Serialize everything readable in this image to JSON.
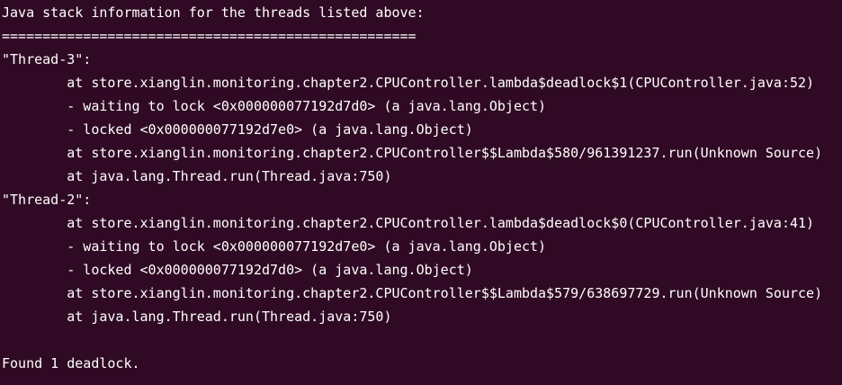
{
  "terminal": {
    "lines": [
      "Java stack information for the threads listed above:",
      "===================================================",
      "\"Thread-3\":",
      "        at store.xianglin.monitoring.chapter2.CPUController.lambda$deadlock$1(CPUController.java:52)",
      "        - waiting to lock <0x000000077192d7d0> (a java.lang.Object)",
      "        - locked <0x000000077192d7e0> (a java.lang.Object)",
      "        at store.xianglin.monitoring.chapter2.CPUController$$Lambda$580/961391237.run(Unknown Source)",
      "        at java.lang.Thread.run(Thread.java:750)",
      "\"Thread-2\":",
      "        at store.xianglin.monitoring.chapter2.CPUController.lambda$deadlock$0(CPUController.java:41)",
      "        - waiting to lock <0x000000077192d7e0> (a java.lang.Object)",
      "        - locked <0x000000077192d7d0> (a java.lang.Object)",
      "        at store.xianglin.monitoring.chapter2.CPUController$$Lambda$579/638697729.run(Unknown Source)",
      "        at java.lang.Thread.run(Thread.java:750)",
      "",
      "Found 1 deadlock."
    ]
  },
  "colors": {
    "background": "#300a24",
    "foreground": "#ffffff"
  }
}
